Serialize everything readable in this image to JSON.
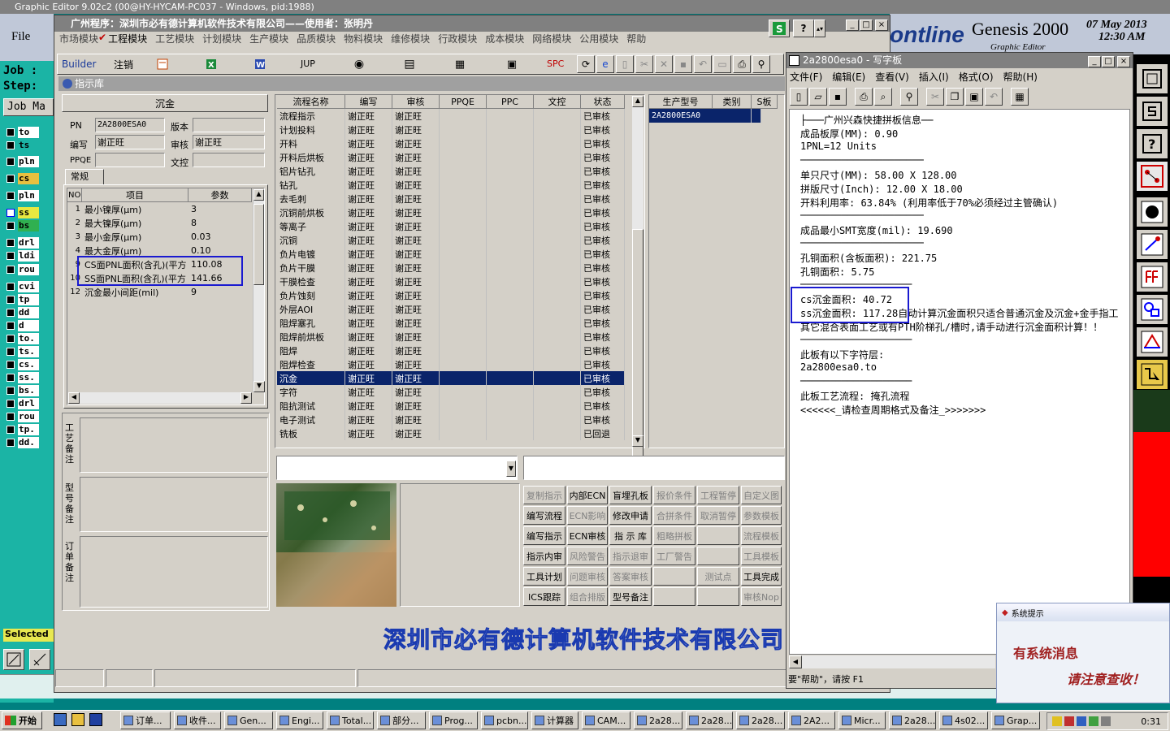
{
  "ge": {
    "title": "Graphic Editor 9.02c2 (00@HY-HYCAM-PC037 - Windows, pid:1988)",
    "menu_file": "File",
    "menu_e": "E",
    "job": "Job :",
    "step": "Step:",
    "jobma": "Job Ma",
    "selected": "Selected",
    "brand": "ontline",
    "genesis": "Genesis 2000",
    "sub": "Graphic Editor",
    "date": "07 May 2013",
    "time": "12:30 AM",
    "layers": [
      "to",
      "ts",
      "pln",
      "cs",
      "pln",
      "ss",
      "bs",
      "drl",
      "ldi",
      "rou",
      "cvi",
      "tp",
      "dd",
      "d",
      "to.",
      "ts.",
      "cs.",
      "ss.",
      "bs.",
      "drl",
      "rou",
      "tp.",
      "dd."
    ]
  },
  "erp": {
    "title": "广州程序：深圳市必有德计算机软件技术有限公司——使用者：张明丹",
    "menus": [
      "市场模块",
      "工程模块",
      "工艺模块",
      "计划模块",
      "生产模块",
      "品质模块",
      "物料模块",
      "维修模块",
      "行政模块",
      "成本模块",
      "网络模块",
      "公用模块",
      "帮助"
    ],
    "builder": "Builder",
    "logout": "注销",
    "jup": "JUP",
    "spc": "SPC",
    "subtitle": "指示库",
    "process_name": "沉金",
    "pn_label": "PN",
    "pn": "2A2800ESA0",
    "ver_label": "版本",
    "ver": "",
    "writer_label": "编写",
    "writer": "谢正旺",
    "review_label": "审核",
    "reviewer": "谢正旺",
    "ppqe_label": "PPQE",
    "ppqe": "",
    "doc_label": "文控",
    "doc": "",
    "tab": "常规",
    "param_headers": [
      "NO",
      "项目",
      "参数"
    ],
    "params": [
      [
        "1",
        "最小镍厚(μm)",
        "3"
      ],
      [
        "2",
        "最大镍厚(μm)",
        "8"
      ],
      [
        "3",
        "最小金厚(μm)",
        "0.03"
      ],
      [
        "4",
        "最大金厚(μm)",
        "0.10"
      ],
      [
        "9",
        "CS面PNL面积(含孔)(平方",
        "110.08"
      ],
      [
        "10",
        "SS面PNL面积(含孔)(平方",
        "141.66"
      ],
      [
        "12",
        "沉金最小间距(mil)",
        "9"
      ]
    ],
    "note1": "工艺备注",
    "note2": "型号备注",
    "note3": "订单备注",
    "flow_headers": [
      "流程名称",
      "编写",
      "审核",
      "PPQE",
      "PPC",
      "文控",
      "状态"
    ],
    "flows": [
      [
        "流程指示",
        "谢正旺",
        "谢正旺",
        "已审核"
      ],
      [
        "计划投料",
        "谢正旺",
        "谢正旺",
        "已审核"
      ],
      [
        "开料",
        "谢正旺",
        "谢正旺",
        "已审核"
      ],
      [
        "开料后烘板",
        "谢正旺",
        "谢正旺",
        "已审核"
      ],
      [
        "铝片钻孔",
        "谢正旺",
        "谢正旺",
        "已审核"
      ],
      [
        "钻孔",
        "谢正旺",
        "谢正旺",
        "已审核"
      ],
      [
        "去毛刺",
        "谢正旺",
        "谢正旺",
        "已审核"
      ],
      [
        "沉铜前烘板",
        "谢正旺",
        "谢正旺",
        "已审核"
      ],
      [
        "等离子",
        "谢正旺",
        "谢正旺",
        "已审核"
      ],
      [
        "沉铜",
        "谢正旺",
        "谢正旺",
        "已审核"
      ],
      [
        "负片电镀",
        "谢正旺",
        "谢正旺",
        "已审核"
      ],
      [
        "负片干膜",
        "谢正旺",
        "谢正旺",
        "已审核"
      ],
      [
        "干膜检查",
        "谢正旺",
        "谢正旺",
        "已审核"
      ],
      [
        "负片蚀刻",
        "谢正旺",
        "谢正旺",
        "已审核"
      ],
      [
        "外层AOI",
        "谢正旺",
        "谢正旺",
        "已审核"
      ],
      [
        "阻焊塞孔",
        "谢正旺",
        "谢正旺",
        "已审核"
      ],
      [
        "阻焊前烘板",
        "谢正旺",
        "谢正旺",
        "已审核"
      ],
      [
        "阻焊",
        "谢正旺",
        "谢正旺",
        "已审核"
      ],
      [
        "阻焊检查",
        "谢正旺",
        "谢正旺",
        "已审核"
      ],
      [
        "沉金",
        "谢正旺",
        "谢正旺",
        "已审核"
      ],
      [
        "字符",
        "谢正旺",
        "谢正旺",
        "已审核"
      ],
      [
        "阻抗测试",
        "谢正旺",
        "谢正旺",
        "已审核"
      ],
      [
        "电子测试",
        "谢正旺",
        "谢正旺",
        "已审核"
      ],
      [
        "铣板",
        "谢正旺",
        "谢正旺",
        "已回退"
      ]
    ],
    "model_headers": [
      "生产型号",
      "类别",
      "S板"
    ],
    "model_row": "2A2800ESA0",
    "buttons": [
      [
        "复制指示",
        "内部ECN",
        "盲埋孔板",
        "报价条件",
        "工程暂停",
        "自定义图"
      ],
      [
        "编写流程",
        "ECN影响",
        "修改申请",
        "合拼条件",
        "取消暂停",
        "参数模板"
      ],
      [
        "编写指示",
        "ECN审核",
        "指 示 库",
        "粗略拼板",
        "",
        "流程模板"
      ],
      [
        "指示内审",
        "风险警告",
        "指示退审",
        "工厂警告",
        "",
        "工具模板"
      ],
      [
        "工具计划",
        "问题审核",
        "答案审核",
        "",
        "测试点",
        "工具完成"
      ],
      [
        "ICS跟踪",
        "组合排版",
        "型号备注",
        "",
        "",
        "审核Nop"
      ]
    ],
    "company": "深圳市必有德计算机软件技术有限公司"
  },
  "wp": {
    "title": "2a2800esa0 - 写字板",
    "menus": [
      "文件(F)",
      "编辑(E)",
      "查看(V)",
      "插入(I)",
      "格式(O)",
      "帮助(H)"
    ],
    "lines": [
      "├───广州兴森快捷拼板信息──",
      "成品板厚(MM): 0.90",
      "1PNL=12 Units",
      "─────────────────────",
      "单只尺寸(MM): 58.00 X 128.00",
      "拼版尺寸(Inch): 12.00 X 18.00",
      "开料利用率: 63.84% (利用率低于70%必须经过主管确认)",
      "─────────────────────",
      "成品最小SMT宽度(mil): 19.690",
      "─────────────────────",
      "孔铜面积(含板面积): 221.75",
      "孔铜面积: 5.75",
      "───────────────────",
      "cs沉金面积: 40.72",
      "ss沉金面积: 117.28自动计算沉金面积只适合普通沉金及沉金+金手指工",
      "其它混合表面工艺或有PTH阶梯孔/槽时,请手动进行沉金面积计算！！",
      "───────────────────",
      "此板有以下字符层:",
      "2a2800esa0.to",
      "───────────────────",
      "此板工艺流程: 掩孔流程",
      "<<<<<<_请检查周期格式及备注_>>>>>>>"
    ],
    "status": "要\"帮助\"，请按 F1"
  },
  "notify": {
    "title": "系统提示",
    "line1": "有系统消息",
    "line2": "请注意查收！"
  },
  "taskbar": {
    "start": "开始",
    "items": [
      "订单...",
      "收件...",
      "Gen...",
      "Engi...",
      "Total...",
      "部分...",
      "Prog...",
      "pcbn...",
      "计算器",
      "CAM...",
      "2a28...",
      "2a28...",
      "2a28...",
      "2A2...",
      "Micr...",
      "2a28...",
      "4s02...",
      "Grap..."
    ],
    "clock": "0:31"
  },
  "colors": {
    "selection": "#0a246a",
    "highlight_box": "#1a1ad0",
    "titlebar": "#0a246a"
  }
}
